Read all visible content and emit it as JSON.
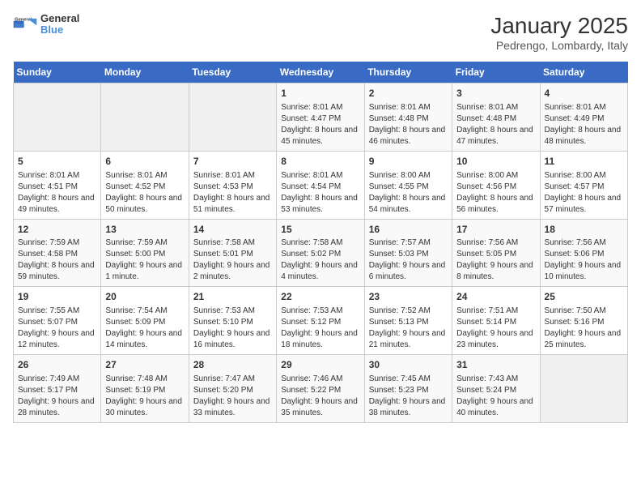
{
  "logo": {
    "general": "General",
    "blue": "Blue"
  },
  "title": "January 2025",
  "subtitle": "Pedrengo, Lombardy, Italy",
  "days_of_week": [
    "Sunday",
    "Monday",
    "Tuesday",
    "Wednesday",
    "Thursday",
    "Friday",
    "Saturday"
  ],
  "weeks": [
    [
      {
        "day": "",
        "info": ""
      },
      {
        "day": "",
        "info": ""
      },
      {
        "day": "",
        "info": ""
      },
      {
        "day": "1",
        "info": "Sunrise: 8:01 AM\nSunset: 4:47 PM\nDaylight: 8 hours and 45 minutes."
      },
      {
        "day": "2",
        "info": "Sunrise: 8:01 AM\nSunset: 4:48 PM\nDaylight: 8 hours and 46 minutes."
      },
      {
        "day": "3",
        "info": "Sunrise: 8:01 AM\nSunset: 4:48 PM\nDaylight: 8 hours and 47 minutes."
      },
      {
        "day": "4",
        "info": "Sunrise: 8:01 AM\nSunset: 4:49 PM\nDaylight: 8 hours and 48 minutes."
      }
    ],
    [
      {
        "day": "5",
        "info": "Sunrise: 8:01 AM\nSunset: 4:51 PM\nDaylight: 8 hours and 49 minutes."
      },
      {
        "day": "6",
        "info": "Sunrise: 8:01 AM\nSunset: 4:52 PM\nDaylight: 8 hours and 50 minutes."
      },
      {
        "day": "7",
        "info": "Sunrise: 8:01 AM\nSunset: 4:53 PM\nDaylight: 8 hours and 51 minutes."
      },
      {
        "day": "8",
        "info": "Sunrise: 8:01 AM\nSunset: 4:54 PM\nDaylight: 8 hours and 53 minutes."
      },
      {
        "day": "9",
        "info": "Sunrise: 8:00 AM\nSunset: 4:55 PM\nDaylight: 8 hours and 54 minutes."
      },
      {
        "day": "10",
        "info": "Sunrise: 8:00 AM\nSunset: 4:56 PM\nDaylight: 8 hours and 56 minutes."
      },
      {
        "day": "11",
        "info": "Sunrise: 8:00 AM\nSunset: 4:57 PM\nDaylight: 8 hours and 57 minutes."
      }
    ],
    [
      {
        "day": "12",
        "info": "Sunrise: 7:59 AM\nSunset: 4:58 PM\nDaylight: 8 hours and 59 minutes."
      },
      {
        "day": "13",
        "info": "Sunrise: 7:59 AM\nSunset: 5:00 PM\nDaylight: 9 hours and 1 minute."
      },
      {
        "day": "14",
        "info": "Sunrise: 7:58 AM\nSunset: 5:01 PM\nDaylight: 9 hours and 2 minutes."
      },
      {
        "day": "15",
        "info": "Sunrise: 7:58 AM\nSunset: 5:02 PM\nDaylight: 9 hours and 4 minutes."
      },
      {
        "day": "16",
        "info": "Sunrise: 7:57 AM\nSunset: 5:03 PM\nDaylight: 9 hours and 6 minutes."
      },
      {
        "day": "17",
        "info": "Sunrise: 7:56 AM\nSunset: 5:05 PM\nDaylight: 9 hours and 8 minutes."
      },
      {
        "day": "18",
        "info": "Sunrise: 7:56 AM\nSunset: 5:06 PM\nDaylight: 9 hours and 10 minutes."
      }
    ],
    [
      {
        "day": "19",
        "info": "Sunrise: 7:55 AM\nSunset: 5:07 PM\nDaylight: 9 hours and 12 minutes."
      },
      {
        "day": "20",
        "info": "Sunrise: 7:54 AM\nSunset: 5:09 PM\nDaylight: 9 hours and 14 minutes."
      },
      {
        "day": "21",
        "info": "Sunrise: 7:53 AM\nSunset: 5:10 PM\nDaylight: 9 hours and 16 minutes."
      },
      {
        "day": "22",
        "info": "Sunrise: 7:53 AM\nSunset: 5:12 PM\nDaylight: 9 hours and 18 minutes."
      },
      {
        "day": "23",
        "info": "Sunrise: 7:52 AM\nSunset: 5:13 PM\nDaylight: 9 hours and 21 minutes."
      },
      {
        "day": "24",
        "info": "Sunrise: 7:51 AM\nSunset: 5:14 PM\nDaylight: 9 hours and 23 minutes."
      },
      {
        "day": "25",
        "info": "Sunrise: 7:50 AM\nSunset: 5:16 PM\nDaylight: 9 hours and 25 minutes."
      }
    ],
    [
      {
        "day": "26",
        "info": "Sunrise: 7:49 AM\nSunset: 5:17 PM\nDaylight: 9 hours and 28 minutes."
      },
      {
        "day": "27",
        "info": "Sunrise: 7:48 AM\nSunset: 5:19 PM\nDaylight: 9 hours and 30 minutes."
      },
      {
        "day": "28",
        "info": "Sunrise: 7:47 AM\nSunset: 5:20 PM\nDaylight: 9 hours and 33 minutes."
      },
      {
        "day": "29",
        "info": "Sunrise: 7:46 AM\nSunset: 5:22 PM\nDaylight: 9 hours and 35 minutes."
      },
      {
        "day": "30",
        "info": "Sunrise: 7:45 AM\nSunset: 5:23 PM\nDaylight: 9 hours and 38 minutes."
      },
      {
        "day": "31",
        "info": "Sunrise: 7:43 AM\nSunset: 5:24 PM\nDaylight: 9 hours and 40 minutes."
      },
      {
        "day": "",
        "info": ""
      }
    ]
  ]
}
